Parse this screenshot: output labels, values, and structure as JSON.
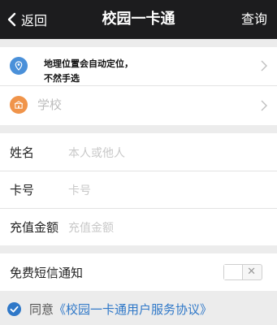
{
  "navbar": {
    "back_label": "返回",
    "title": "校园一卡通",
    "action_label": "查询"
  },
  "location": {
    "line1": "地理位置会自动定位，",
    "line2": "不然手选",
    "school_placeholder": "学校"
  },
  "form": {
    "name_label": "姓名",
    "name_placeholder": "本人或他人",
    "card_label": "卡号",
    "card_placeholder": "卡号",
    "amount_label": "充值金额",
    "amount_placeholder": "充值金额"
  },
  "sms": {
    "label": "免费短信通知",
    "toggle_off_symbol": "✕"
  },
  "agreement": {
    "prefix": "同意",
    "link": "《校园一卡通用户服务协议》"
  },
  "colors": {
    "navbar": "#1c1c1e",
    "accent_blue": "#2f78c8",
    "location_icon_blue": "#4a90d9",
    "school_icon_orange": "#f0944a"
  },
  "icons": [
    "back-chevron-icon",
    "location-pin-icon",
    "school-icon",
    "chevron-right-icon",
    "check-circle-icon"
  ]
}
